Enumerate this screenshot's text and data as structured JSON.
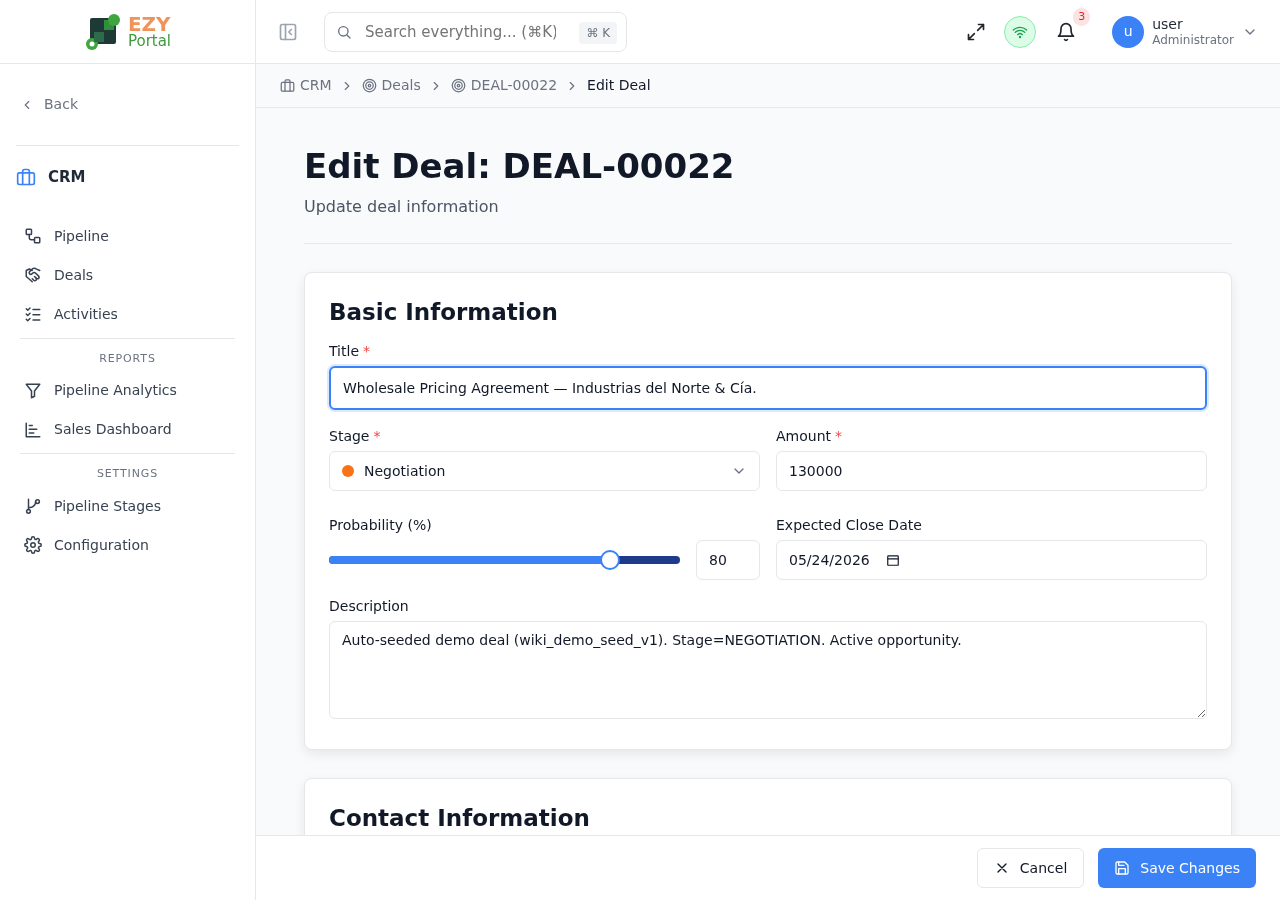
{
  "logo": {
    "line_1": "EZY",
    "line_2": "Portal"
  },
  "sidebar": {
    "back": "Back",
    "module": "CRM",
    "groups": [
      {
        "items": [
          {
            "label": "Pipeline"
          },
          {
            "label": "Deals"
          },
          {
            "label": "Activities"
          }
        ]
      },
      {
        "heading": "REPORTS",
        "items": [
          {
            "label": "Pipeline Analytics"
          },
          {
            "label": "Sales Dashboard"
          }
        ]
      },
      {
        "heading": "SETTINGS",
        "items": [
          {
            "label": "Pipeline Stages"
          },
          {
            "label": "Configuration"
          }
        ]
      }
    ]
  },
  "header": {
    "search": {
      "placeholder": "Search everything... (⌘K)",
      "shortcut": "⌘ K"
    },
    "notifications": "3",
    "user": {
      "initial": "u",
      "name": "user",
      "role": "Administrator"
    }
  },
  "breadcrumb": [
    {
      "label": "CRM"
    },
    {
      "label": "Deals"
    },
    {
      "label": "DEAL-00022"
    },
    {
      "label": "Edit Deal"
    }
  ],
  "page": {
    "title": "Edit Deal: DEAL-00022",
    "subtitle": "Update deal information"
  },
  "basic": {
    "heading": "Basic Information",
    "title": {
      "label": "Title",
      "required_mark": "*",
      "value": "Wholesale Pricing Agreement — Industrias del Norte & Cía."
    },
    "stage": {
      "label": "Stage",
      "required_mark": "*",
      "value": "Negotiation",
      "color": "#f97316"
    },
    "amount": {
      "label": "Amount",
      "required_mark": "*",
      "value": "130000"
    },
    "probability": {
      "label": "Probability (%)",
      "level": 0.8,
      "value": "80"
    },
    "close_date": {
      "label": "Expected Close Date",
      "value": "05/24/2026"
    },
    "description": {
      "label": "Description",
      "value": "Auto-seeded demo deal (wiki_demo_seed_v1). Stage=NEGOTIATION. Active opportunity."
    }
  },
  "contact": {
    "heading": "Contact Information"
  },
  "footer": {
    "cancel": "Cancel",
    "save": "Save Changes"
  }
}
